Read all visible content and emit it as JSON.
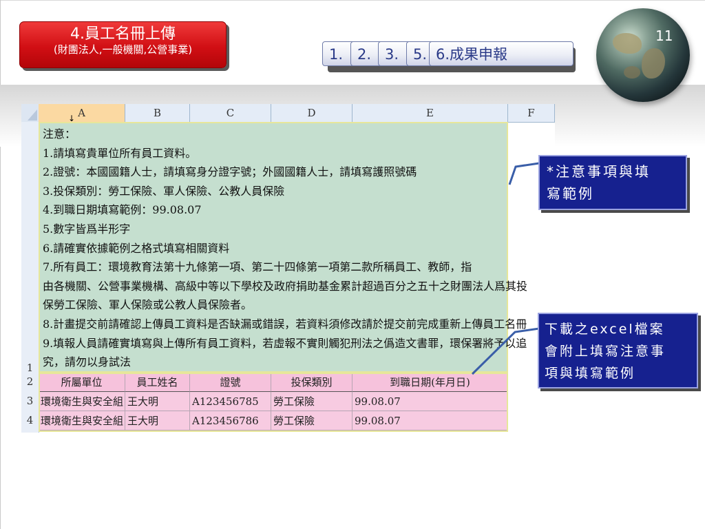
{
  "title_box": {
    "main": "4.員工名冊上傳",
    "sub": "(財團法人,一般機關,公營事業)"
  },
  "tabs": [
    {
      "label": "1.",
      "ghost": ""
    },
    {
      "label": "2.",
      "ghost": ""
    },
    {
      "label": "3.",
      "ghost": ""
    },
    {
      "label": "5.",
      "ghost": ""
    },
    {
      "label": "6.成果申報",
      "ghost": ""
    }
  ],
  "page_number": "11",
  "sheet": {
    "columns": [
      "A",
      "B",
      "C",
      "D",
      "E",
      "F"
    ],
    "row_numbers": [
      "1",
      "2",
      "3",
      "4"
    ],
    "notes": [
      "注意：",
      "1.請填寫貴單位所有員工資料。",
      "2.證號：本國國籍人士，請填寫身分證字號；外國國籍人士，請填寫護照號碼",
      "3.投保類別：勞工保險、軍人保險、公教人員保險",
      "4.到職日期填寫範例：99.08.07",
      "5.數字皆爲半形字",
      "6.請確實依據範例之格式填寫相關資料",
      "7.所有員工：環境教育法第十九條第一項、第二十四條第一項第二款所稱員工、教師，指",
      "由各機關、公營事業機構、高級中等以下學校及政府捐助基金累計超過百分之五十之財團法人爲其投",
      "保勞工保險、軍人保險或公教人員保險者。",
      "8.計畫提交前請確認上傳員工資料是否缺漏或錯誤，若資料須修改請於提交前完成重新上傳員工名冊",
      "9.填報人員請確實填寫與上傳所有員工資料，若虛報不實則觸犯刑法之僞造文書罪，環保署將予以追",
      "究，請勿以身試法"
    ],
    "headers": [
      "所屬單位",
      "員工姓名",
      "證號",
      "投保類別",
      "到職日期(年月日)"
    ],
    "rows": [
      [
        "環境衛生與安全組",
        "王大明",
        "A123456785",
        "勞工保險",
        "99.08.07"
      ],
      [
        "環境衛生與安全組",
        "王大明",
        "A123456786",
        "勞工保險",
        "99.08.07"
      ]
    ]
  },
  "callouts": {
    "notes_line1": "*注意事項與填",
    "notes_line2": "寫範例",
    "download_line1": "下載之excel檔案",
    "download_line2": "會附上填寫注意事",
    "download_line3": "項與填寫範例"
  },
  "colors": {
    "title_red": "#d10f14",
    "tab_text": "#2a3a88",
    "notes_green": "#c5dfcf",
    "table_pink": "#f7cbe1",
    "callout_blue": "#16218f",
    "connector": "#3a5ea8"
  },
  "icons": [
    "globe-icon",
    "down-arrow-icon",
    "select-all-corner-icon"
  ]
}
